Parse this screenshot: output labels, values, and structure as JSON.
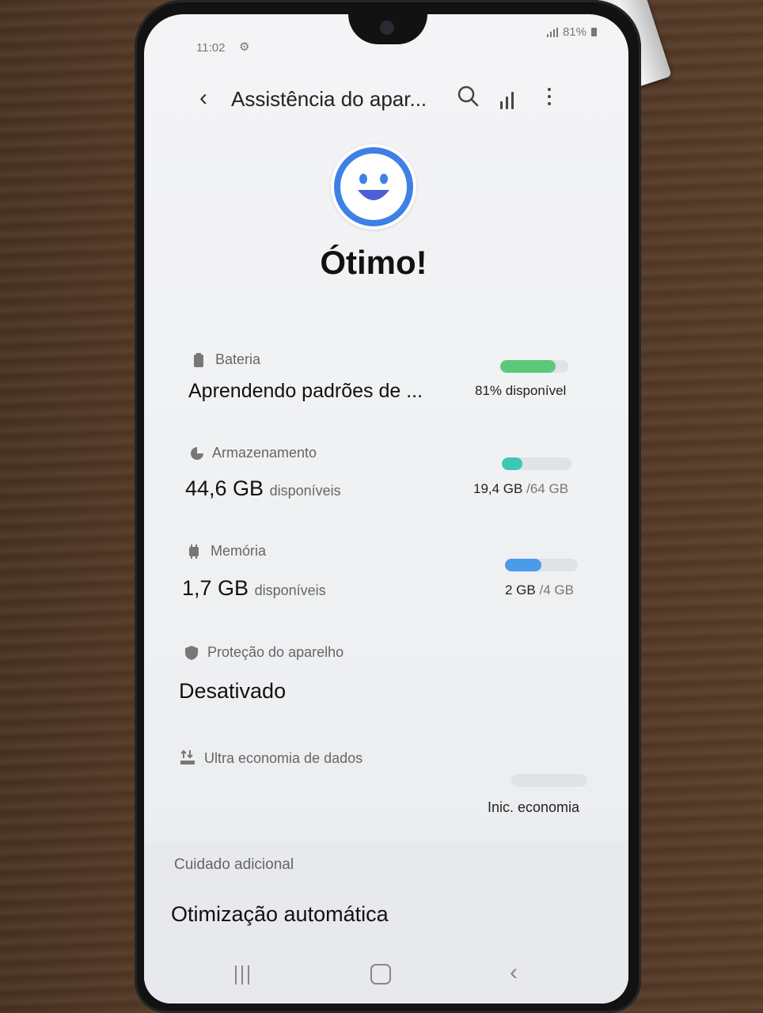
{
  "status_bar": {
    "time": "11:02",
    "battery": "81%"
  },
  "header": {
    "title": "Assistência do apar..."
  },
  "status": {
    "title": "Ótimo!"
  },
  "battery": {
    "label": "Bateria",
    "value": "Aprendendo padrões de ...",
    "available": "81% disponível",
    "level": 0.81,
    "color": "#5cc97a"
  },
  "storage": {
    "label": "Armazenamento",
    "value": "44,6 GB",
    "unit": "disponíveis",
    "used": "19,4 GB",
    "total": "/64 GB",
    "fraction": 0.3,
    "color": "#3ec8b4"
  },
  "memory": {
    "label": "Memória",
    "value": "1,7 GB",
    "unit": "disponíveis",
    "used": "2 GB",
    "total": "/4 GB",
    "fraction": 0.5,
    "color": "#4a9be8"
  },
  "protection": {
    "label": "Proteção do aparelho",
    "value": "Desativado"
  },
  "data_saver": {
    "label": "Ultra economia de dados",
    "action": "Inic. economia"
  },
  "extra_care": {
    "label": "Cuidado adicional",
    "auto_optimization": "Otimização automática"
  },
  "icons": {
    "back": "chevron-left-icon",
    "search": "search-icon",
    "stats": "bar-chart-icon",
    "more": "more-vertical-icon",
    "smiley": "smiley-face-icon",
    "battery": "battery-icon",
    "storage": "pie-chart-icon",
    "memory": "memory-chip-icon",
    "shield": "shield-icon",
    "data": "data-saver-icon"
  }
}
